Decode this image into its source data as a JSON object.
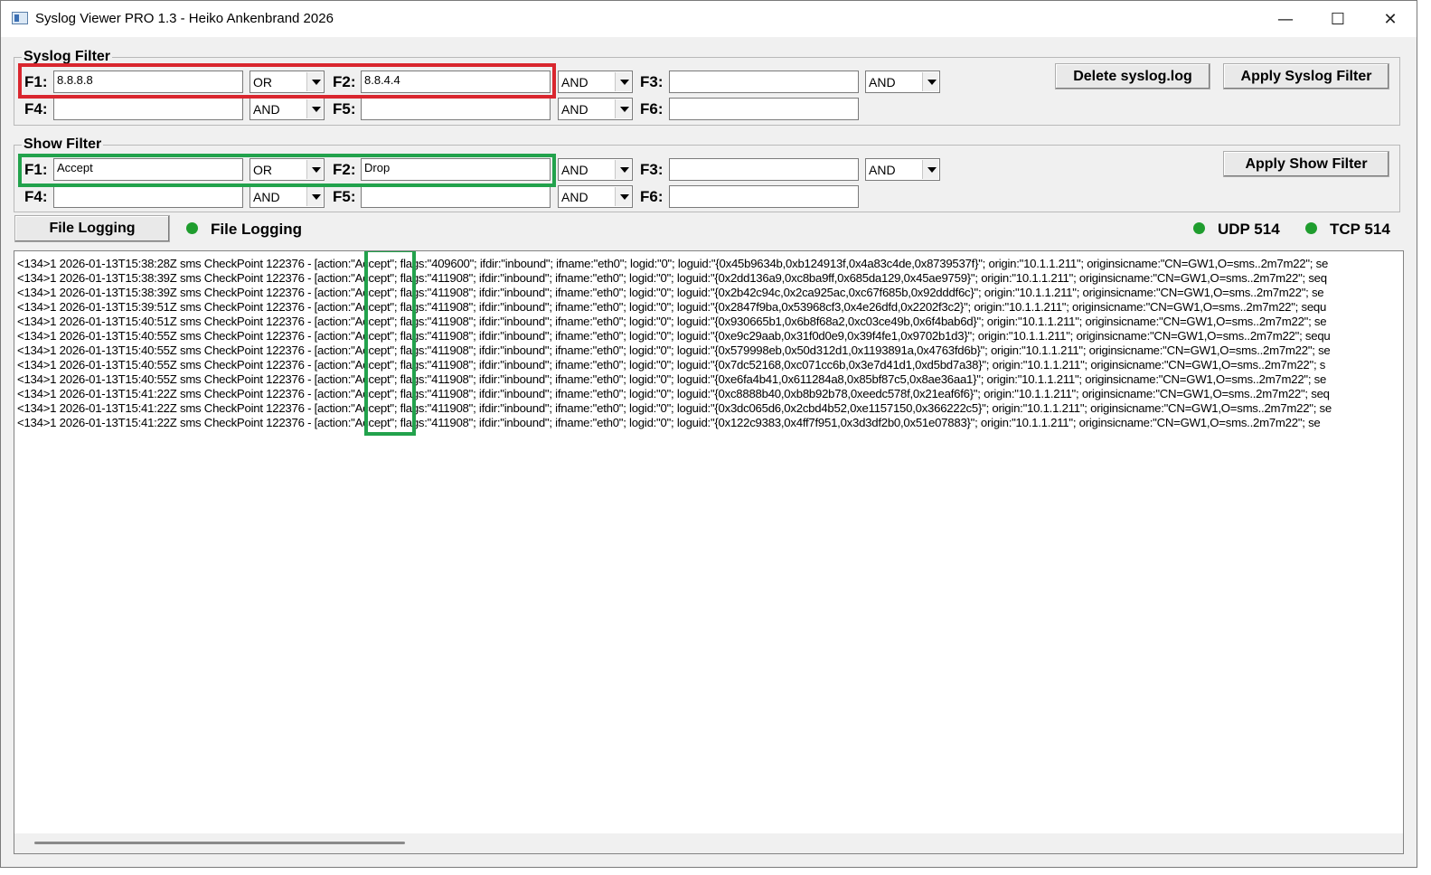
{
  "window": {
    "title": "Syslog Viewer PRO 1.3 - Heiko Ankenbrand 2026",
    "minimize_glyph": "—",
    "maximize_glyph": "☐",
    "close_glyph": "✕"
  },
  "syslog_filter": {
    "legend": "Syslog Filter",
    "labels": {
      "f1": "F1:",
      "f2": "F2:",
      "f3": "F3:",
      "f4": "F4:",
      "f5": "F5:",
      "f6": "F6:"
    },
    "f1": "8.8.8.8",
    "f2": "8.8.4.4",
    "f3": "",
    "f4": "",
    "f5": "",
    "f6": "",
    "op_f1_f2": "OR",
    "op_f2_f3": "AND",
    "op_f3_f4": "AND",
    "op_f4_f5": "AND",
    "op_f5_f6": "AND",
    "delete_button": "Delete syslog.log",
    "apply_button": "Apply Syslog Filter",
    "highlight_color": "#d9262e"
  },
  "show_filter": {
    "legend": "Show Filter",
    "labels": {
      "f1": "F1:",
      "f2": "F2:",
      "f3": "F3:",
      "f4": "F4:",
      "f5": "F5:",
      "f6": "F6:"
    },
    "f1": "Accept",
    "f2": "Drop",
    "f3": "",
    "f4": "",
    "f5": "",
    "f6": "",
    "op_f1_f2": "OR",
    "op_f2_f3": "AND",
    "op_f3_f4": "AND",
    "op_f4_f5": "AND",
    "op_f5_f6": "AND",
    "apply_button": "Apply Show Filter",
    "highlight_color": "#22a24c"
  },
  "status": {
    "file_logging_button": "File Logging",
    "file_logging_label": "File Logging",
    "udp_label": "UDP 514",
    "tcp_label": "TCP 514",
    "led_color": "#1f9d2e"
  },
  "log_lines": [
    "<134>1 2026-01-13T15:38:28Z sms CheckPoint 122376 - [action:\"Accept\"; flags:\"409600\"; ifdir:\"inbound\"; ifname:\"eth0\"; logid:\"0\"; loguid:\"{0x45b9634b,0xb124913f,0x4a83c4de,0x8739537f}\"; origin:\"10.1.1.211\"; originsicname:\"CN=GW1,O=sms..2m7m22\"; se",
    "<134>1 2026-01-13T15:38:39Z sms CheckPoint 122376 - [action:\"Accept\"; flags:\"411908\"; ifdir:\"inbound\"; ifname:\"eth0\"; logid:\"0\"; loguid:\"{0x2dd136a9,0xc8ba9ff,0x685da129,0x45ae9759}\"; origin:\"10.1.1.211\"; originsicname:\"CN=GW1,O=sms..2m7m22\"; seq",
    "<134>1 2026-01-13T15:38:39Z sms CheckPoint 122376 - [action:\"Accept\"; flags:\"411908\"; ifdir:\"inbound\"; ifname:\"eth0\"; logid:\"0\"; loguid:\"{0x2b42c94c,0x2ca925ac,0xc67f685b,0x92dddf6c}\"; origin:\"10.1.1.211\"; originsicname:\"CN=GW1,O=sms..2m7m22\"; se",
    "<134>1 2026-01-13T15:39:51Z sms CheckPoint 122376 - [action:\"Accept\"; flags:\"411908\"; ifdir:\"inbound\"; ifname:\"eth0\"; logid:\"0\"; loguid:\"{0x2847f9ba,0x53968cf3,0x4e26dfd,0x2202f3c2}\"; origin:\"10.1.1.211\"; originsicname:\"CN=GW1,O=sms..2m7m22\"; sequ",
    "<134>1 2026-01-13T15:40:51Z sms CheckPoint 122376 - [action:\"Accept\"; flags:\"411908\"; ifdir:\"inbound\"; ifname:\"eth0\"; logid:\"0\"; loguid:\"{0x930665b1,0x6b8f68a2,0xc03ce49b,0x6f4bab6d}\"; origin:\"10.1.1.211\"; originsicname:\"CN=GW1,O=sms..2m7m22\"; se",
    "<134>1 2026-01-13T15:40:55Z sms CheckPoint 122376 - [action:\"Accept\"; flags:\"411908\"; ifdir:\"inbound\"; ifname:\"eth0\"; logid:\"0\"; loguid:\"{0xe9c29aab,0x31f0d0e9,0x39f4fe1,0x9702b1d3}\"; origin:\"10.1.1.211\"; originsicname:\"CN=GW1,O=sms..2m7m22\"; sequ",
    "<134>1 2026-01-13T15:40:55Z sms CheckPoint 122376 - [action:\"Accept\"; flags:\"411908\"; ifdir:\"inbound\"; ifname:\"eth0\"; logid:\"0\"; loguid:\"{0x579998eb,0x50d312d1,0x1193891a,0x4763fd6b}\"; origin:\"10.1.1.211\"; originsicname:\"CN=GW1,O=sms..2m7m22\"; se",
    "<134>1 2026-01-13T15:40:55Z sms CheckPoint 122376 - [action:\"Accept\"; flags:\"411908\"; ifdir:\"inbound\"; ifname:\"eth0\"; logid:\"0\"; loguid:\"{0x7dc52168,0xc071cc6b,0x3e7d41d1,0xd5bd7a38}\"; origin:\"10.1.1.211\"; originsicname:\"CN=GW1,O=sms..2m7m22\"; s",
    "<134>1 2026-01-13T15:40:55Z sms CheckPoint 122376 - [action:\"Accept\"; flags:\"411908\"; ifdir:\"inbound\"; ifname:\"eth0\"; logid:\"0\"; loguid:\"{0xe6fa4b41,0x611284a8,0x85bf87c5,0x8ae36aa1}\"; origin:\"10.1.1.211\"; originsicname:\"CN=GW1,O=sms..2m7m22\"; se",
    "<134>1 2026-01-13T15:41:22Z sms CheckPoint 122376 - [action:\"Accept\"; flags:\"411908\"; ifdir:\"inbound\"; ifname:\"eth0\"; logid:\"0\"; loguid:\"{0xc8888b40,0xb8b92b78,0xeedc578f,0x21eaf6f6}\"; origin:\"10.1.1.211\"; originsicname:\"CN=GW1,O=sms..2m7m22\"; seq",
    "<134>1 2026-01-13T15:41:22Z sms CheckPoint 122376 - [action:\"Accept\"; flags:\"411908\"; ifdir:\"inbound\"; ifname:\"eth0\"; logid:\"0\"; loguid:\"{0x3dc065d6,0x2cbd4b52,0xe1157150,0x366222c5}\"; origin:\"10.1.1.211\"; originsicname:\"CN=GW1,O=sms..2m7m22\"; se",
    "<134>1 2026-01-13T15:41:22Z sms CheckPoint 122376 - [action:\"Accept\"; flags:\"411908\"; ifdir:\"inbound\"; ifname:\"eth0\"; logid:\"0\"; loguid:\"{0x122c9383,0x4ff7f951,0x3d3df2b0,0x51e07883}\"; origin:\"10.1.1.211\"; originsicname:\"CN=GW1,O=sms..2m7m22\"; se"
  ]
}
